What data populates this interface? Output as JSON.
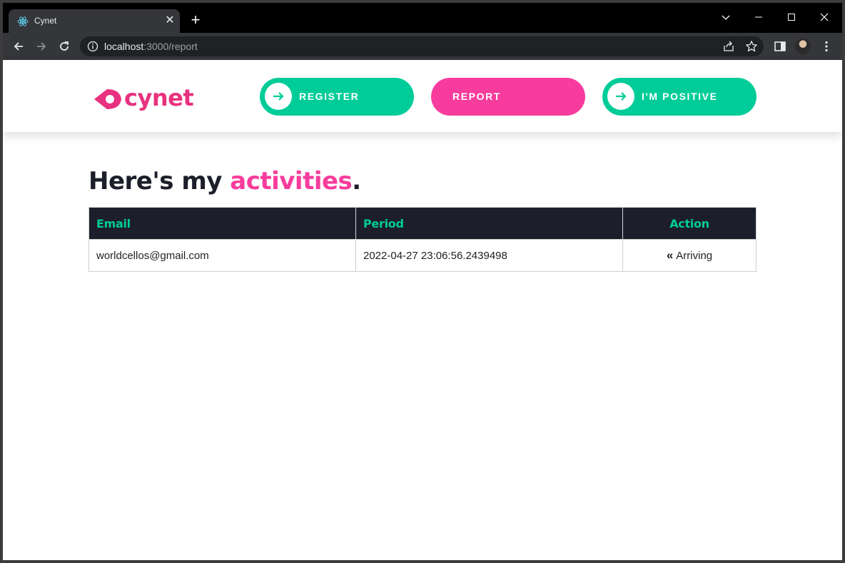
{
  "browser": {
    "tab_title": "Cynet",
    "url_host": "localhost",
    "url_path": ":3000/report",
    "close_glyph": "✕",
    "new_tab_glyph": "+",
    "controls": {
      "dropdown": "⌄",
      "minimize": "—",
      "maximize": "☐",
      "close": "✕"
    }
  },
  "site": {
    "logo_text": "cynet",
    "brand_pink": "#f73c9d",
    "brand_green": "#00cc99",
    "nav": [
      {
        "label": "REGISTER",
        "color": "green",
        "arrow": true
      },
      {
        "label": "REPORT",
        "color": "pink",
        "arrow": false
      },
      {
        "label": "I'M POSITIVE",
        "color": "green",
        "arrow": true
      }
    ]
  },
  "main": {
    "heading_prefix": "Here's my ",
    "heading_accent": "activities",
    "heading_suffix": ".",
    "table": {
      "headers": {
        "email": "Email",
        "period": "Period",
        "action": "Action"
      },
      "rows": [
        {
          "email": "worldcellos@gmail.com",
          "period": "2022-04-27 23:06:56.2439498",
          "action_icon": "«",
          "action": "Arriving"
        }
      ]
    }
  }
}
